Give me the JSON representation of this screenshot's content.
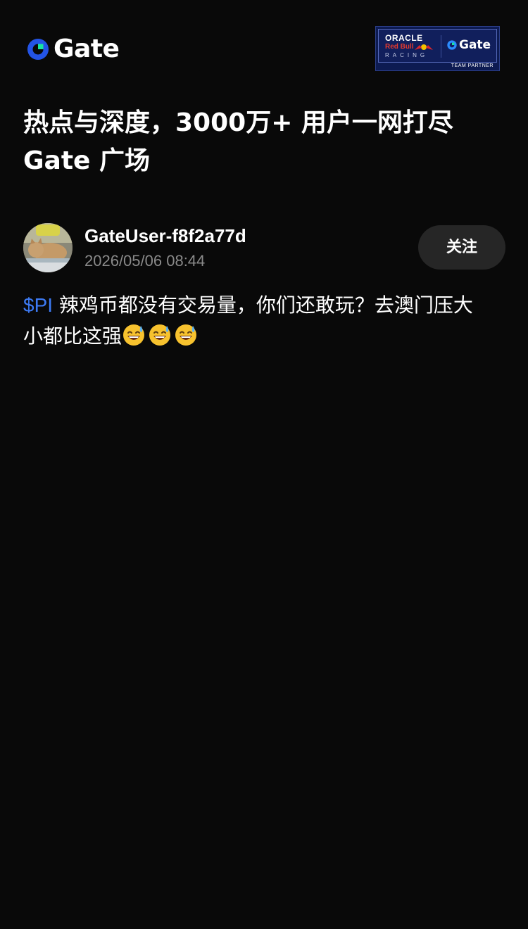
{
  "header": {
    "logo_text": "Gate",
    "brand_color": "#2354e6",
    "accent_color": "#17e6a1",
    "partner_badge": {
      "oracle": "ORACLE",
      "redbull": "Red Bull",
      "racing": "RACING",
      "gate": "Gate",
      "team_partner": "TEAM PARTNER"
    }
  },
  "headline": {
    "line1": "热点与深度，3000万+ 用户一网打尽",
    "line2": "Gate 广场"
  },
  "post": {
    "username": "GateUser-f8f2a77d",
    "timestamp": "2026/05/06 08:44",
    "follow_label": "关注",
    "ticker": "$PI",
    "text_line1": " 辣鸡币都没有交易量，你们还敢玩？去澳门压大",
    "text_line2": "小都比这强",
    "emojis": [
      "grinning-sweat-emoji",
      "grinning-sweat-emoji",
      "grinning-sweat-emoji"
    ],
    "link_color": "#3d7bf5"
  }
}
